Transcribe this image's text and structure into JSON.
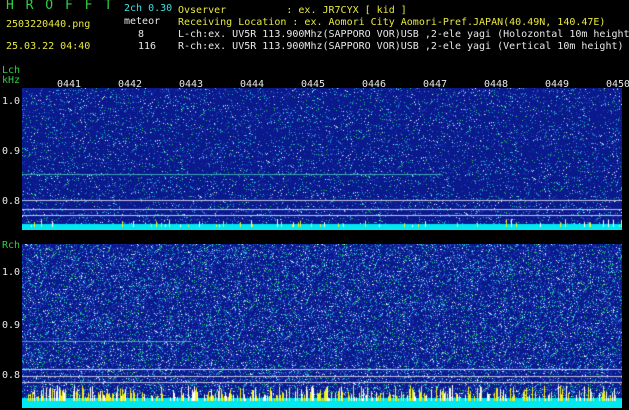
{
  "header": {
    "title": "H R O F F T",
    "filename": "2503220440.png",
    "datetime": "25.03.22 04:40",
    "version": "2ch 0.30",
    "type_label": "meteor",
    "count_l": "8",
    "count_r": "116",
    "observer": "Ovserver          : ex. JR7CYX [ kid ]",
    "location": "Receiving Location : ex. Aomori City Aomori-Pref.JAPAN(40.49N, 140.47E)",
    "lch_info": "L-ch:ex. UV5R 113.900Mhz(SAPPORO VOR)USB ,2-ele yagi (Holozontal 10m height)",
    "rch_info": "R-ch:ex. UV5R 113.900Mhz(SAPPORO VOR)USB ,2-ele yagi (Vertical 10m height)"
  },
  "lch": {
    "label": "Lch",
    "unit": "kHz",
    "ticks": [
      "1.0",
      "0.9",
      "0.8"
    ]
  },
  "rch": {
    "label": "Rch",
    "ticks": [
      "1.0",
      "0.9",
      "0.8"
    ]
  },
  "time_marks": [
    "0441",
    "0442",
    "0443",
    "0444",
    "0445",
    "0446",
    "0447",
    "0448",
    "0449",
    "0450"
  ],
  "colors": {
    "background": "#000000",
    "spectrum_base": "#0a1a8c",
    "noise_high": "#ffffff",
    "noise_mid": "#40d0ff",
    "noise_low": "#28c060",
    "baseline": "#00e8f0",
    "spike": "#f0f020",
    "grid_line": "#c0c0e0",
    "title_green": "#30d040",
    "filename_yellow": "#e8e840"
  }
}
